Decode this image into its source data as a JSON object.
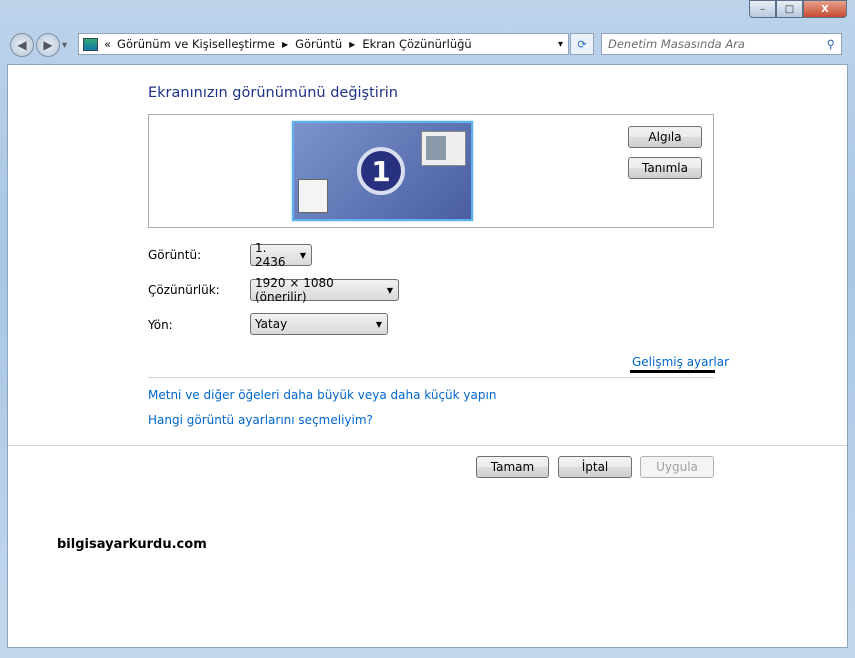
{
  "window": {
    "minimize": "–",
    "maximize": "□",
    "close": "X"
  },
  "nav": {
    "back": "◀",
    "forward": "▶",
    "history": "▾"
  },
  "address": {
    "overflow": "«",
    "crumbs": [
      "Görünüm ve Kişiselleştirme",
      "Görüntü",
      "Ekran Çözünürlüğü"
    ],
    "dropdown": "▾",
    "refresh": "⟳"
  },
  "search": {
    "placeholder": "Denetim Masasında Ara",
    "icon": "⚲"
  },
  "main": {
    "title": "Ekranınızın görünümünü değiştirin",
    "monitor_number": "1",
    "detect": "Algıla",
    "identify": "Tanımla",
    "display_label": "Görüntü:",
    "display_value": "1. 2436",
    "resolution_label": "Çözünürlük:",
    "resolution_value": "1920 × 1080 (önerilir)",
    "orientation_label": "Yön:",
    "orientation_value": "Yatay",
    "advanced": "Gelişmiş ayarlar",
    "link_text_size": "Metni ve diğer öğeleri daha büyük veya daha küçük yapın",
    "link_which": "Hangi görüntü ayarlarını seçmeliyim?",
    "ok": "Tamam",
    "cancel": "İptal",
    "apply": "Uygula"
  },
  "watermark": "bilgisayarkurdu.com"
}
